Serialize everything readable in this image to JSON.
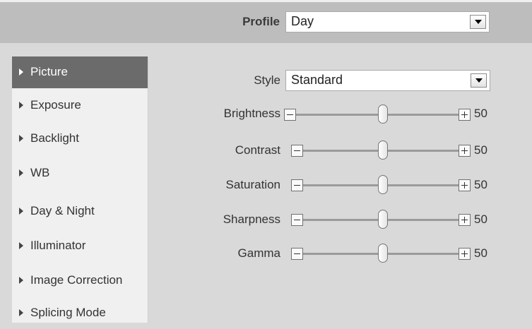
{
  "header": {
    "profile_label": "Profile",
    "profile_value": "Day"
  },
  "sidebar": {
    "items": [
      {
        "label": "Picture",
        "active": true
      },
      {
        "label": "Exposure",
        "active": false
      },
      {
        "label": "Backlight",
        "active": false
      },
      {
        "label": "WB",
        "active": false
      },
      {
        "label": "Day & Night",
        "active": false
      },
      {
        "label": "Illuminator",
        "active": false
      },
      {
        "label": "Image Correction",
        "active": false
      },
      {
        "label": "Splicing Mode",
        "active": false
      }
    ]
  },
  "main": {
    "style_label": "Style",
    "style_value": "Standard",
    "sliders": [
      {
        "label": "Brightness",
        "value": "50"
      },
      {
        "label": "Contrast",
        "value": "50"
      },
      {
        "label": "Saturation",
        "value": "50"
      },
      {
        "label": "Sharpness",
        "value": "50"
      },
      {
        "label": "Gamma",
        "value": "50"
      }
    ]
  },
  "icons": {
    "minus": "minus-icon",
    "plus": "plus-icon",
    "dropdown": "chevron-down-icon",
    "nav_arrow": "caret-right-icon"
  },
  "colors": {
    "active_item_bg": "#6b6b6b",
    "header_bg": "#bdbdbd",
    "page_bg": "#d9d9d9",
    "sidebar_bg": "#f0f0f0"
  }
}
